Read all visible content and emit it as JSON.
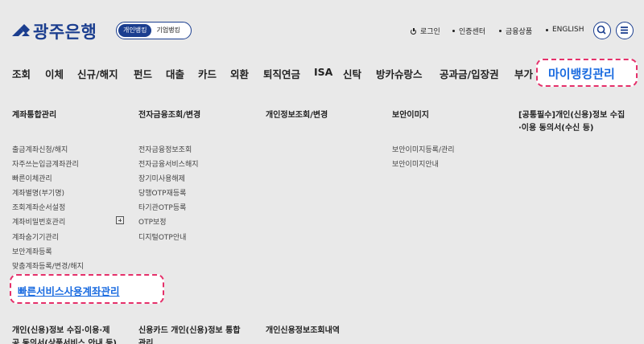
{
  "header": {
    "logo_text": "광주은행",
    "mode_personal": "개인뱅킹",
    "mode_business": "기업뱅킹",
    "util": [
      "로그인",
      "인증센터",
      "금융상품",
      "ENGLISH"
    ],
    "brand_color": "#1b3e8f"
  },
  "gnb": {
    "items": [
      "조회",
      "이체",
      "신규/해지",
      "펀드",
      "대출",
      "카드",
      "외환",
      "퇴직연금",
      "ISA",
      "신탁",
      "방카슈랑스",
      "공과금/입장권",
      "부가"
    ],
    "highlight": "마이뱅킹관리",
    "highlight_color": "#1a6be0",
    "outline_color": "#e5306a"
  },
  "menu": {
    "col1": {
      "title": "계좌통합관리",
      "items": [
        "출금계좌신청/해지",
        "자주쓰는입금계좌관리",
        "빠른이체관리",
        "계좌별명(부기명)",
        "조회계좌순서설정",
        "계좌비밀번호관리",
        "계좌숨기기관리",
        "보안계좌등록",
        "맞춤계좌등록/변경/해지"
      ],
      "highlight": "빠른서비스사용계좌관리"
    },
    "col2": {
      "title": "전자금융조회/변경",
      "items": [
        "전자금융정보조회",
        "전자금융서비스해지",
        "장기미사용해제",
        "당행OTP재등록",
        "타기관OTP등록",
        "OTP보정",
        "디지털OTP안내"
      ]
    },
    "col3": {
      "title": "개인정보조회/변경"
    },
    "col4": {
      "title": "보안이미지",
      "items": [
        "보안이미지등록/관리",
        "보안이미지안내"
      ]
    },
    "col5": {
      "title_line1": "[공통필수]개인(신용)정보 수집",
      "title_line2": "·이용 동의서(수신 등)"
    },
    "row2": {
      "t1_line1": "개인(신용)정보 수집·이용·제",
      "t1_line2": "공 동의서(상품서비스 안내 등)",
      "t2_line1": "신용카드 개인(신용)정보 통합",
      "t2_line2": "관리",
      "t3": "개인신용정보조회내역"
    }
  }
}
